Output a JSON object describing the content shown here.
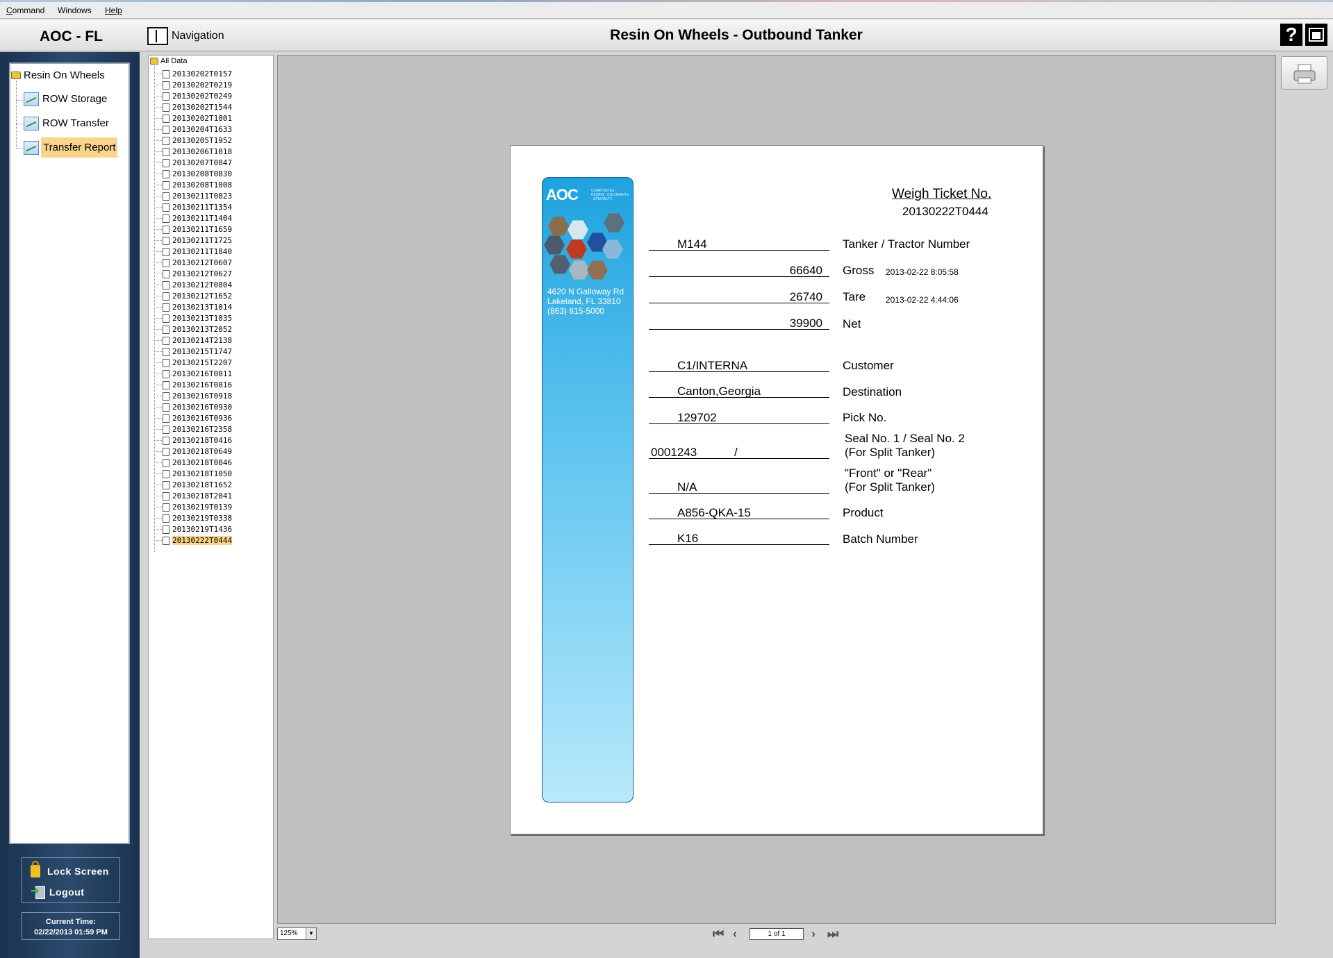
{
  "menu": [
    "Command",
    "Windows",
    "Help"
  ],
  "header": {
    "app_title": "AOC - FL",
    "nav_label": "Navigation",
    "page_title": "Resin On Wheels - Outbound Tanker",
    "help_icon": "help-icon",
    "print_preview_icon": "print-preview-icon"
  },
  "tree": {
    "root": "Resin On Wheels",
    "items": [
      "ROW Storage",
      "ROW Transfer",
      "Transfer Report"
    ],
    "selected": "Transfer Report"
  },
  "sidebar": {
    "lock_label": "Lock Screen",
    "logout_label": "Logout",
    "time_label": "Current Time:",
    "time_value": "02/22/2013 01:59 PM"
  },
  "files": {
    "root": "All Data",
    "items": [
      "20130202T0157",
      "20130202T0219",
      "20130202T0249",
      "20130202T1544",
      "20130202T1801",
      "20130204T1633",
      "20130205T1952",
      "20130206T1018",
      "20130207T0847",
      "20130208T0830",
      "20130208T1008",
      "20130211T0823",
      "20130211T1354",
      "20130211T1404",
      "20130211T1659",
      "20130211T1725",
      "20130211T1840",
      "20130212T0607",
      "20130212T0627",
      "20130212T0804",
      "20130212T1652",
      "20130213T1014",
      "20130213T1035",
      "20130213T2052",
      "20130214T2138",
      "20130215T1747",
      "20130215T2207",
      "20130216T0811",
      "20130216T0816",
      "20130216T0918",
      "20130216T0930",
      "20130216T0936",
      "20130216T2358",
      "20130218T0416",
      "20130218T0649",
      "20130218T0846",
      "20130218T1050",
      "20130218T1652",
      "20130218T2041",
      "20130219T0139",
      "20130219T0338",
      "20130219T1436",
      "20130222T0444"
    ],
    "selected": "20130222T0444"
  },
  "ticket": {
    "logo": "AOC",
    "tagline": "COMPOSITES · RESINS · COLORANTS · SPECIALTY",
    "address": [
      "4620 N Galloway Rd",
      "Lakeland, FL 33810",
      "(863) 815-5000"
    ],
    "heading": "Weigh Ticket No.",
    "number": "20130222T0444",
    "tanker": "M144",
    "tanker_label": "Tanker / Tractor Number",
    "gross": "66640",
    "gross_label": "Gross",
    "gross_time": "2013-02-22 8:05:58",
    "tare": "26740",
    "tare_label": "Tare",
    "tare_time": "2013-02-22 4:44:06",
    "net": "39900",
    "net_label": "Net",
    "customer": "C1/INTERNA",
    "customer_label": "Customer",
    "destination": "Canton,Georgia",
    "destination_label": "Destination",
    "pick": "129702",
    "pick_label": "Pick No.",
    "seal": "0001243",
    "seal_sep": "/",
    "seal_label_1": "Seal No. 1 / Seal No. 2",
    "seal_label_2": "(For Split Tanker)",
    "front_rear": "N/A",
    "front_rear_label_1": "\"Front\" or \"Rear\"",
    "front_rear_label_2": "(For Split Tanker)",
    "product": "A856-QKA-15",
    "product_label": "Product",
    "batch": "K16",
    "batch_label": "Batch Number"
  },
  "viewer": {
    "zoom": "125%",
    "page": "1 of 1"
  }
}
